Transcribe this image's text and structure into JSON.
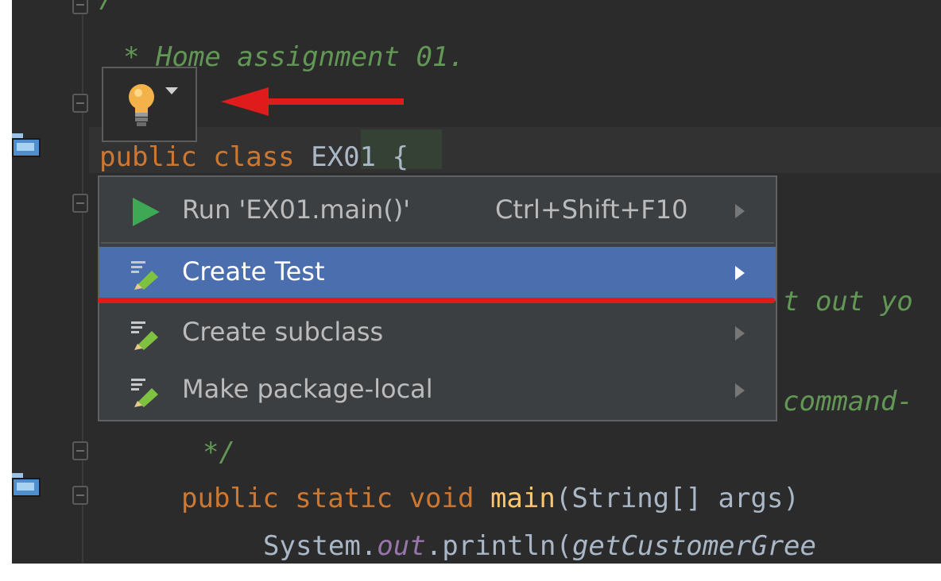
{
  "editor": {
    "lines": [
      {
        "text": "/**"
      },
      {
        "text": "* Home assignment 01."
      },
      {
        "kw": "public class",
        "cls": "EX01",
        "brace": "{"
      },
      {
        "text": "*/"
      },
      {
        "kw": "public static void",
        "fn": "main",
        "rest": "(String[] args)"
      },
      {
        "pre": "System.",
        "field": "out",
        "mid": ".println(",
        "call": "getCustomerGree"
      }
    ],
    "partials": {
      "behind_create_test": "t out yo",
      "behind_make_package": "command-"
    }
  },
  "intention": {
    "icon": "lightbulb-icon",
    "dropdown_icon": "dropdown-triangle-icon",
    "bulb_color": "#f4b24a",
    "annotation_color": "#e01b1b"
  },
  "popup": {
    "items": [
      {
        "label": "Run 'EX01.main()'",
        "shortcut": "Ctrl+Shift+F10",
        "icon": "run-icon",
        "selected": false
      },
      {
        "label": "Create Test",
        "shortcut": "",
        "icon": "intention-pencil-icon",
        "selected": true
      },
      {
        "label": "Create subclass",
        "shortcut": "",
        "icon": "intention-pencil-icon",
        "selected": false
      },
      {
        "label": "Make package-local",
        "shortcut": "",
        "icon": "intention-pencil-icon",
        "selected": false
      }
    ],
    "selected_color": "#4b6eaf"
  }
}
